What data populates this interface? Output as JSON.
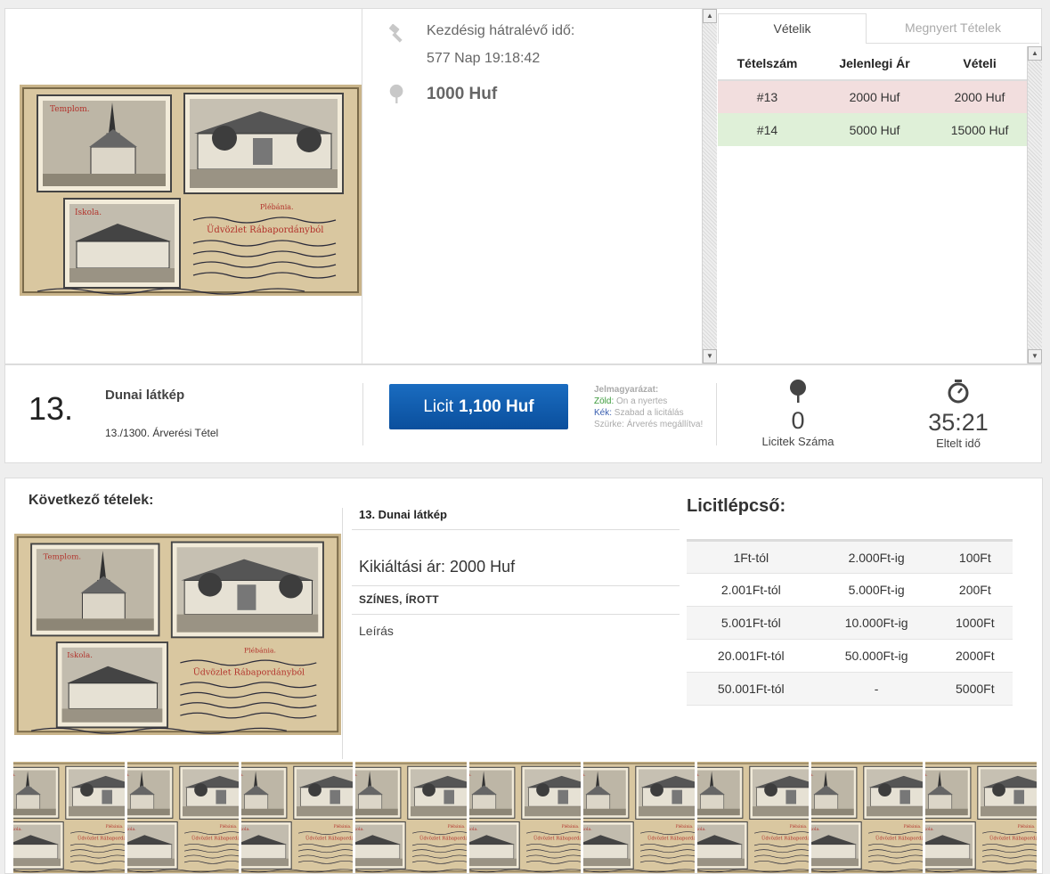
{
  "timer": {
    "start_label": "Kezdésig hátralévő idő:",
    "remaining": "577 Nap 19:18:42",
    "price": "1000 Huf"
  },
  "tabs": [
    {
      "label": "Vételik",
      "active": true
    },
    {
      "label": "Megnyert Tételek",
      "active": false
    }
  ],
  "bids_table": {
    "headers": [
      "Tételszám",
      "Jelenlegi Ár",
      "Vételi"
    ],
    "rows": [
      {
        "lot": "#13",
        "current": "2000 Huf",
        "bid": "2000 Huf",
        "status": "red"
      },
      {
        "lot": "#14",
        "current": "5000 Huf",
        "bid": "15000 Huf",
        "status": "green"
      }
    ]
  },
  "lot": {
    "number": "13.",
    "title": "Dunai látkép",
    "subtitle": "13./1300. Árverési Tétel"
  },
  "bid_button": {
    "prefix": "Licit",
    "amount": "1,100 Huf"
  },
  "legend": {
    "title": "Jelmagyarázat:",
    "green_key": "Zöld:",
    "green_text": "On a nyertes",
    "blue_key": "Kék:",
    "blue_text": "Szabad a licitálás",
    "grey_key": "Szürke:",
    "grey_text": "Árverés megállítva!"
  },
  "stats": {
    "bids_count": "0",
    "bids_label": "Licitek Száma",
    "elapsed": "35:21",
    "elapsed_label": "Eltelt idő"
  },
  "next": {
    "title": "Következő tételek:",
    "item_title": "13. Dunai látkép",
    "start_price": "Kikiáltási ár: 2000 Huf",
    "tag": "SZÍNES, ÍROTT",
    "desc": "Leírás"
  },
  "steps": {
    "title": "Licitlépcső:",
    "rows": [
      [
        "1Ft-tól",
        "2.000Ft-ig",
        "100Ft"
      ],
      [
        "2.001Ft-tól",
        "5.000Ft-ig",
        "200Ft"
      ],
      [
        "5.001Ft-tól",
        "10.000Ft-ig",
        "1000Ft"
      ],
      [
        "20.001Ft-tól",
        "50.000Ft-ig",
        "2000Ft"
      ],
      [
        "50.001Ft-tól",
        "-",
        "5000Ft"
      ]
    ]
  },
  "postcard": {
    "label_church": "Templom.",
    "label_school": "Iskola.",
    "label_parish": "Plébánia.",
    "greeting": "Üdvözlet Rábapordányból"
  },
  "colors": {
    "bid_button": "#0a4f9d",
    "row_red": "#f2dede",
    "row_green": "#dff0d8"
  },
  "thumbnail_count": 9
}
